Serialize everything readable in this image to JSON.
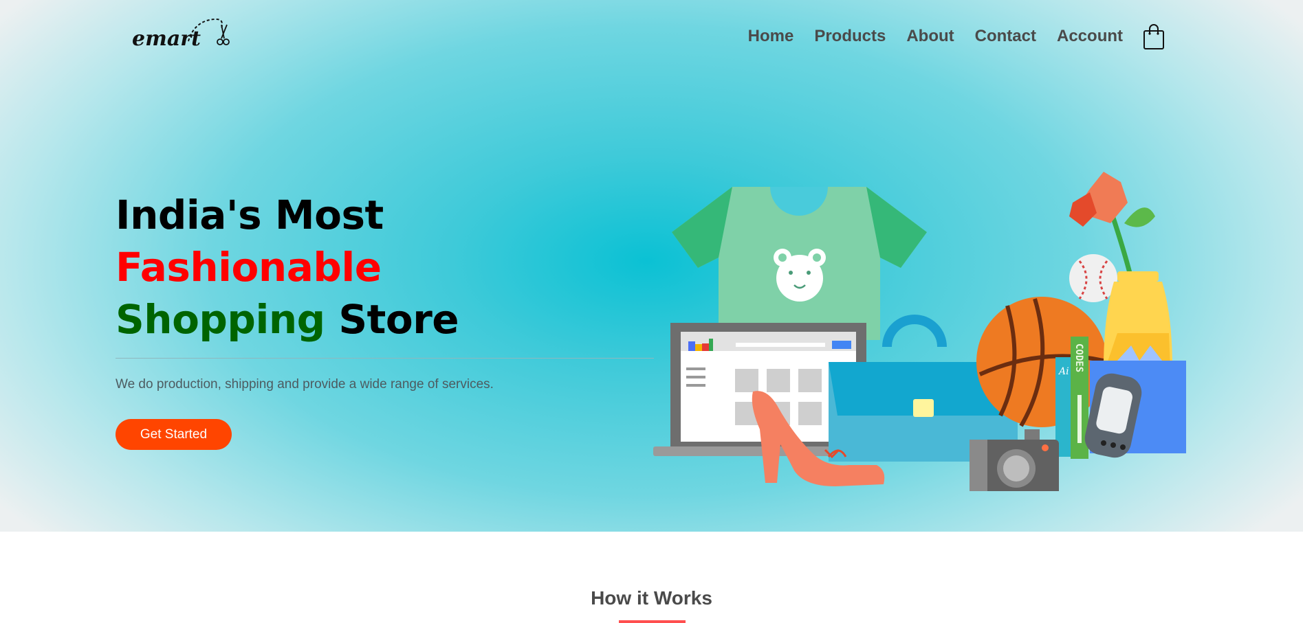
{
  "brand": {
    "logo_text": "emart"
  },
  "nav": {
    "items": [
      {
        "label": "Home"
      },
      {
        "label": "Products"
      },
      {
        "label": "About"
      },
      {
        "label": "Contact"
      },
      {
        "label": "Account"
      }
    ],
    "cart_icon": "shopping-bag-icon"
  },
  "hero": {
    "headline": {
      "line1": "India's Most",
      "line2": "Fashionable",
      "line3_part1": "Shopping",
      "line3_part2": "Store"
    },
    "subtitle": "We do production, shipping and provide a wide range of services.",
    "cta_label": "Get Started",
    "illustration_book_text": "CODES"
  },
  "section": {
    "title": "How it Works"
  },
  "colors": {
    "accent_red": "#ff0000",
    "accent_green": "#006400",
    "cta": "#ff4500",
    "hero_center": "#0bc1d4",
    "underline": "#ff4f4f"
  }
}
